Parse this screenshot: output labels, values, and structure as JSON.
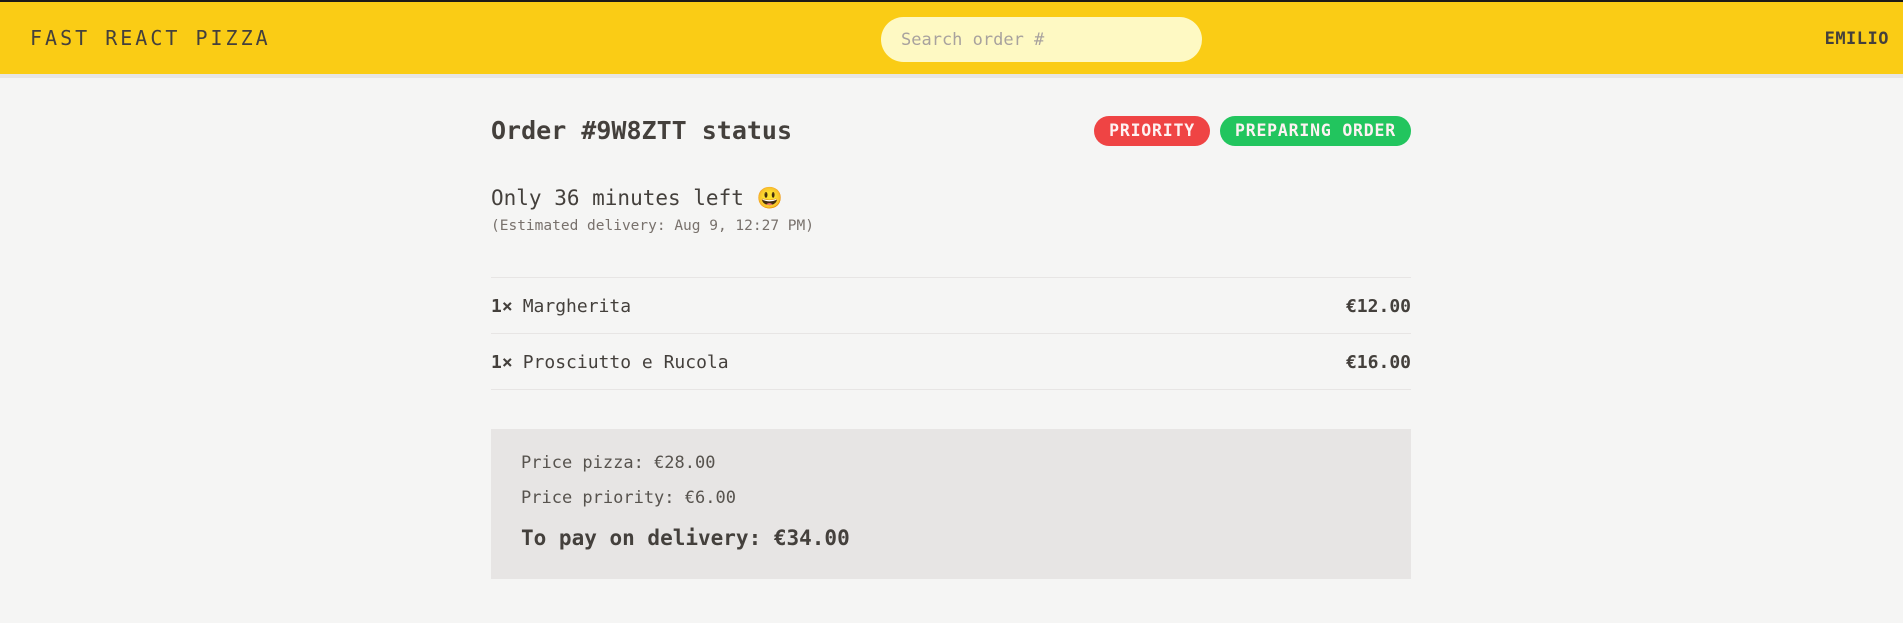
{
  "header": {
    "logo": "FAST REACT PIZZA",
    "search_placeholder": "Search order #",
    "username": "EMILIO"
  },
  "order": {
    "title": "Order #9W8ZTT status",
    "badges": {
      "priority": "PRIORITY",
      "status": "PREPARING ORDER"
    },
    "countdown": "Only 36 minutes left 😃",
    "estimated": "(Estimated delivery: Aug 9, 12:27 PM)",
    "items": [
      {
        "qty": "1×",
        "name": "Margherita",
        "price": "€12.00"
      },
      {
        "qty": "1×",
        "name": "Prosciutto e Rucola",
        "price": "€16.00"
      }
    ],
    "summary": {
      "price_pizza": "Price pizza: €28.00",
      "price_priority": "Price priority: €6.00",
      "total": "To pay on delivery: €34.00"
    }
  },
  "colors": {
    "header_bg": "#facc15",
    "priority_badge": "#ef4444",
    "status_badge": "#22c55e",
    "summary_bg": "#e7e5e4"
  }
}
